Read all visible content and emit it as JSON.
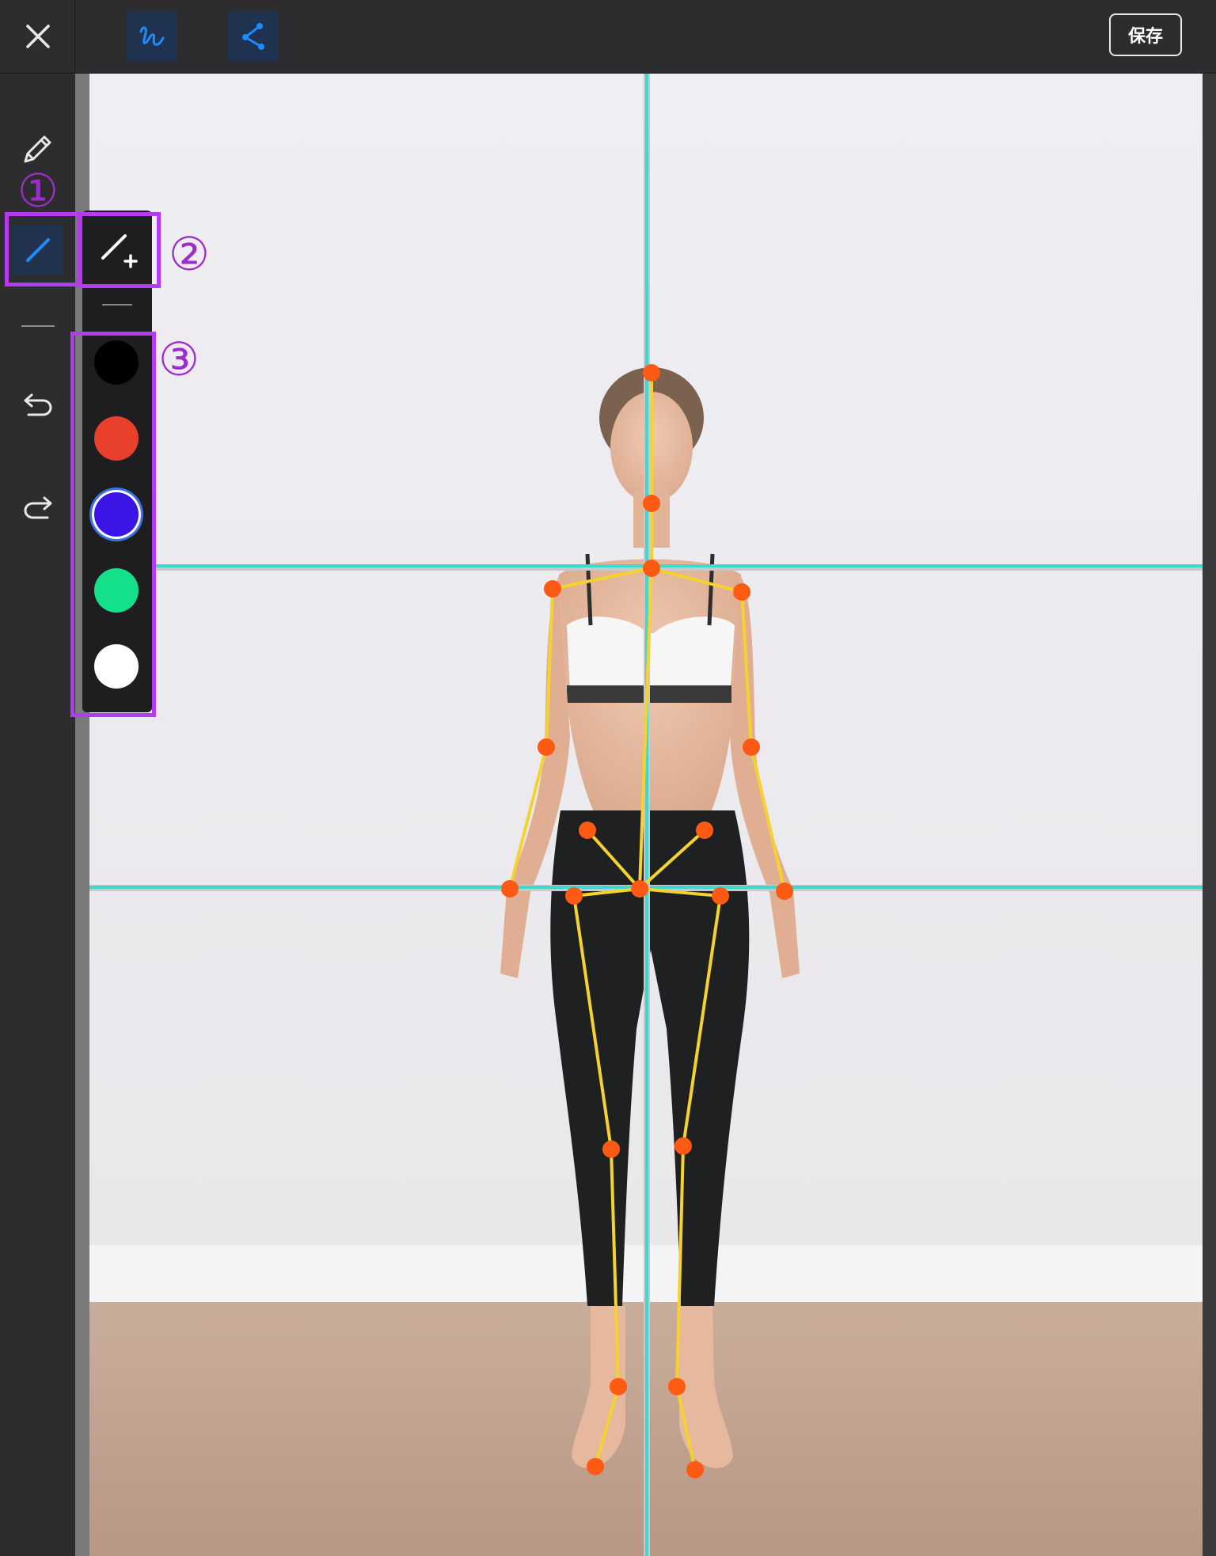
{
  "toolbar": {
    "save_label": "保存",
    "icons": {
      "close": "close-icon",
      "freehand_mode": "freehand-draw-icon",
      "skeleton_mode": "skeleton-nodes-icon"
    }
  },
  "sidebar": {
    "icons": [
      "pencil-icon",
      "straight-line-icon",
      "undo-icon",
      "redo-icon"
    ],
    "line_tools": [
      "straight-line-tool",
      "add-line-tool"
    ]
  },
  "palette": {
    "colors": [
      "#000000",
      "#e8402a",
      "#3b14e6",
      "#14e08a",
      "#ffffff"
    ],
    "selected_index": 2
  },
  "annotations": {
    "marker1": "①",
    "marker2": "②",
    "marker3": "③",
    "color": "#b43bf0"
  },
  "canvas": {
    "guide_color": "#3fd8d0",
    "skeleton_line_color": "#f6d230",
    "joint_color": "#ff5a14"
  }
}
